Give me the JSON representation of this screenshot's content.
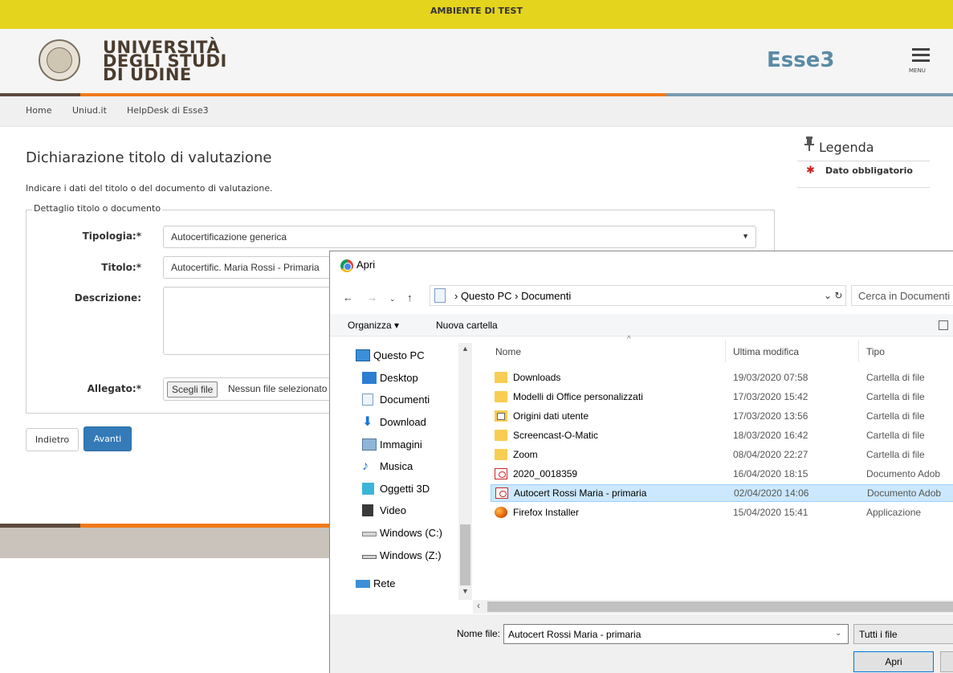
{
  "banner": "AMBIENTE DI TEST",
  "logo": {
    "line1": "UNIVERSITÀ",
    "line2": "DEGLI STUDI",
    "line3": "DI UDINE"
  },
  "app_name": "Esse3",
  "menu_label": "MENU",
  "nav": [
    "Home",
    "Uniud.it",
    "HelpDesk di Esse3"
  ],
  "page": {
    "title": "Dichiarazione titolo di valutazione",
    "subtitle": "Indicare i dati del titolo o del documento di valutazione.",
    "legend": "Dettaglio titolo o documento",
    "fields": {
      "tipologia_label": "Tipologia:*",
      "tipologia_value": "Autocertificazione generica",
      "titolo_label": "Titolo:*",
      "titolo_value": "Autocertific. Maria Rossi - Primaria",
      "descrizione_label": "Descrizione:",
      "allegato_label": "Allegato:*",
      "file_button": "Scegli file",
      "file_status": "Nessun file selezionato"
    },
    "back_button": "Indietro",
    "next_button": "Avanti"
  },
  "legenda": {
    "title": "Legenda",
    "item": "Dato obbligatorio"
  },
  "dialog": {
    "title": "Apri",
    "breadcrumb": "›  Questo PC  ›  Documenti",
    "search_placeholder": "Cerca in Documenti",
    "toolbar": {
      "organize": "Organizza ▾",
      "new_folder": "Nuova cartella"
    },
    "nav_items": [
      {
        "label": "Questo PC",
        "icon": "computer-icon"
      },
      {
        "label": "Desktop",
        "icon": "desktop-icon"
      },
      {
        "label": "Documenti",
        "icon": "documents-icon"
      },
      {
        "label": "Download",
        "icon": "download-icon"
      },
      {
        "label": "Immagini",
        "icon": "pictures-icon"
      },
      {
        "label": "Musica",
        "icon": "music-icon"
      },
      {
        "label": "Oggetti 3D",
        "icon": "3d-objects-icon"
      },
      {
        "label": "Video",
        "icon": "video-icon"
      },
      {
        "label": "Windows (C:)",
        "icon": "drive-icon"
      },
      {
        "label": "Windows (Z:)",
        "icon": "network-drive-icon"
      },
      {
        "label": "Rete",
        "icon": "network-icon"
      }
    ],
    "columns": {
      "name": "Nome",
      "modified": "Ultima modifica",
      "type": "Tipo"
    },
    "files": [
      {
        "name": "Downloads",
        "modified": "19/03/2020 07:58",
        "type": "Cartella di file",
        "icon": "folder-icon"
      },
      {
        "name": "Modelli di Office personalizzati",
        "modified": "17/03/2020 15:42",
        "type": "Cartella di file",
        "icon": "folder-icon"
      },
      {
        "name": "Origini dati utente",
        "modified": "17/03/2020 13:56",
        "type": "Cartella di file",
        "icon": "data-source-folder-icon"
      },
      {
        "name": "Screencast-O-Matic",
        "modified": "18/03/2020 16:42",
        "type": "Cartella di file",
        "icon": "folder-icon"
      },
      {
        "name": "Zoom",
        "modified": "08/04/2020 22:27",
        "type": "Cartella di file",
        "icon": "folder-icon"
      },
      {
        "name": "2020_0018359",
        "modified": "16/04/2020 18:15",
        "type": "Documento Adob",
        "icon": "pdf-icon"
      },
      {
        "name": "Autocert Rossi Maria - primaria",
        "modified": "02/04/2020 14:06",
        "type": "Documento Adob",
        "icon": "pdf-icon",
        "selected": true
      },
      {
        "name": "Firefox Installer",
        "modified": "15/04/2020 15:41",
        "type": "Applicazione",
        "icon": "firefox-icon"
      }
    ],
    "filename_label": "Nome file:",
    "filename_value": "Autocert Rossi Maria - primaria",
    "filetype": "Tutti i file",
    "open_button": "Apri"
  }
}
